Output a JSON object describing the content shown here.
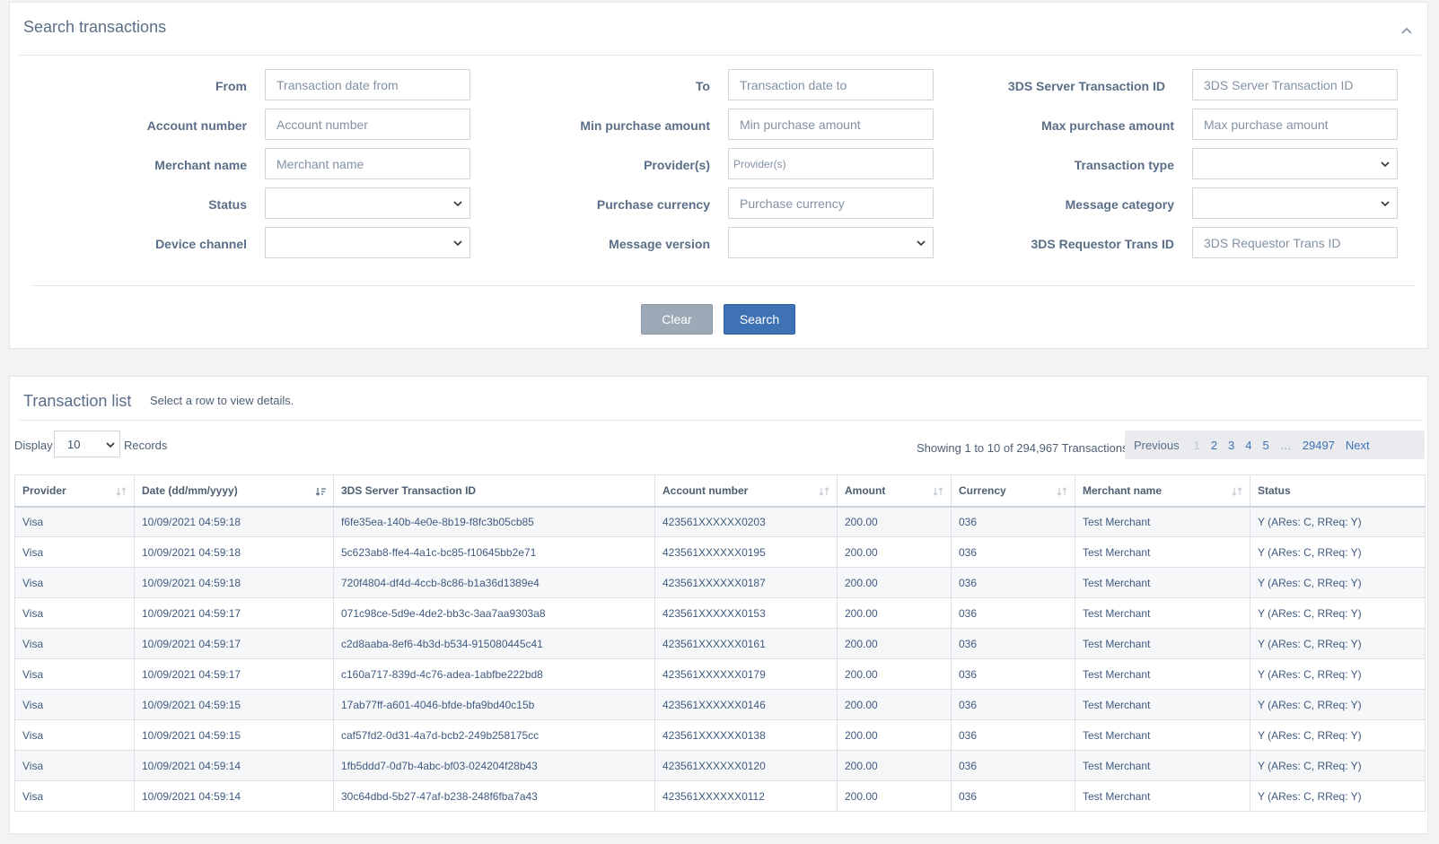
{
  "search": {
    "title": "Search transactions",
    "labels": {
      "from": "From",
      "to": "To",
      "server_id": "3DS Server Transaction ID",
      "account": "Account number",
      "min_amount": "Min purchase amount",
      "max_amount": "Max purchase amount",
      "merchant": "Merchant name",
      "providers": "Provider(s)",
      "tx_type": "Transaction type",
      "status": "Status",
      "currency": "Purchase currency",
      "msg_category": "Message category",
      "device": "Device channel",
      "msg_version": "Message version",
      "requestor_id": "3DS Requestor Trans ID"
    },
    "placeholders": {
      "from": "Transaction date from",
      "to": "Transaction date to",
      "server_id": "3DS Server Transaction ID",
      "account": "Account number",
      "min_amount": "Min purchase amount",
      "max_amount": "Max purchase amount",
      "merchant": "Merchant name",
      "providers": "Provider(s)",
      "currency": "Purchase currency",
      "requestor_id": "3DS Requestor Trans ID"
    },
    "clear_label": "Clear",
    "search_label": "Search"
  },
  "list": {
    "title": "Transaction list",
    "hint": "Select a row to view details.",
    "display_label": "Display",
    "display_value": "10",
    "records_label": "Records",
    "showing": "Showing 1 to 10 of 294,967 Transactions.",
    "pager": {
      "prev": "Previous",
      "pages": [
        "1",
        "2",
        "3",
        "4",
        "5"
      ],
      "ellipsis": "…",
      "last": "29497",
      "next": "Next"
    },
    "columns": [
      "Provider",
      "Date (dd/mm/yyyy)",
      "3DS Server Transaction ID",
      "Account number",
      "Amount",
      "Currency",
      "Merchant name",
      "Status"
    ],
    "rows": [
      [
        "Visa",
        "10/09/2021 04:59:18",
        "f6fe35ea-140b-4e0e-8b19-f8fc3b05cb85",
        "423561XXXXXX0203",
        "200.00",
        "036",
        "Test Merchant",
        "Y (ARes: C, RReq: Y)"
      ],
      [
        "Visa",
        "10/09/2021 04:59:18",
        "5c623ab8-ffe4-4a1c-bc85-f10645bb2e71",
        "423561XXXXXX0195",
        "200.00",
        "036",
        "Test Merchant",
        "Y (ARes: C, RReq: Y)"
      ],
      [
        "Visa",
        "10/09/2021 04:59:18",
        "720f4804-df4d-4ccb-8c86-b1a36d1389e4",
        "423561XXXXXX0187",
        "200.00",
        "036",
        "Test Merchant",
        "Y (ARes: C, RReq: Y)"
      ],
      [
        "Visa",
        "10/09/2021 04:59:17",
        "071c98ce-5d9e-4de2-bb3c-3aa7aa9303a8",
        "423561XXXXXX0153",
        "200.00",
        "036",
        "Test Merchant",
        "Y (ARes: C, RReq: Y)"
      ],
      [
        "Visa",
        "10/09/2021 04:59:17",
        "c2d8aaba-8ef6-4b3d-b534-915080445c41",
        "423561XXXXXX0161",
        "200.00",
        "036",
        "Test Merchant",
        "Y (ARes: C, RReq: Y)"
      ],
      [
        "Visa",
        "10/09/2021 04:59:17",
        "c160a717-839d-4c76-adea-1abfbe222bd8",
        "423561XXXXXX0179",
        "200.00",
        "036",
        "Test Merchant",
        "Y (ARes: C, RReq: Y)"
      ],
      [
        "Visa",
        "10/09/2021 04:59:15",
        "17ab77ff-a601-4046-bfde-bfa9bd40c15b",
        "423561XXXXXX0146",
        "200.00",
        "036",
        "Test Merchant",
        "Y (ARes: C, RReq: Y)"
      ],
      [
        "Visa",
        "10/09/2021 04:59:15",
        "caf57fd2-0d31-4a7d-bcb2-249b258175cc",
        "423561XXXXXX0138",
        "200.00",
        "036",
        "Test Merchant",
        "Y (ARes: C, RReq: Y)"
      ],
      [
        "Visa",
        "10/09/2021 04:59:14",
        "1fb5ddd7-0d7b-4abc-bf03-024204f28b43",
        "423561XXXXXX0120",
        "200.00",
        "036",
        "Test Merchant",
        "Y (ARes: C, RReq: Y)"
      ],
      [
        "Visa",
        "10/09/2021 04:59:14",
        "30c64dbd-5b27-47af-b238-248f6fba7a43",
        "423561XXXXXX0112",
        "200.00",
        "036",
        "Test Merchant",
        "Y (ARes: C, RReq: Y)"
      ]
    ]
  },
  "icons": {
    "collapse": "chevron-up-icon",
    "select": "chevron-down-icon",
    "sort": "sort-icon"
  }
}
